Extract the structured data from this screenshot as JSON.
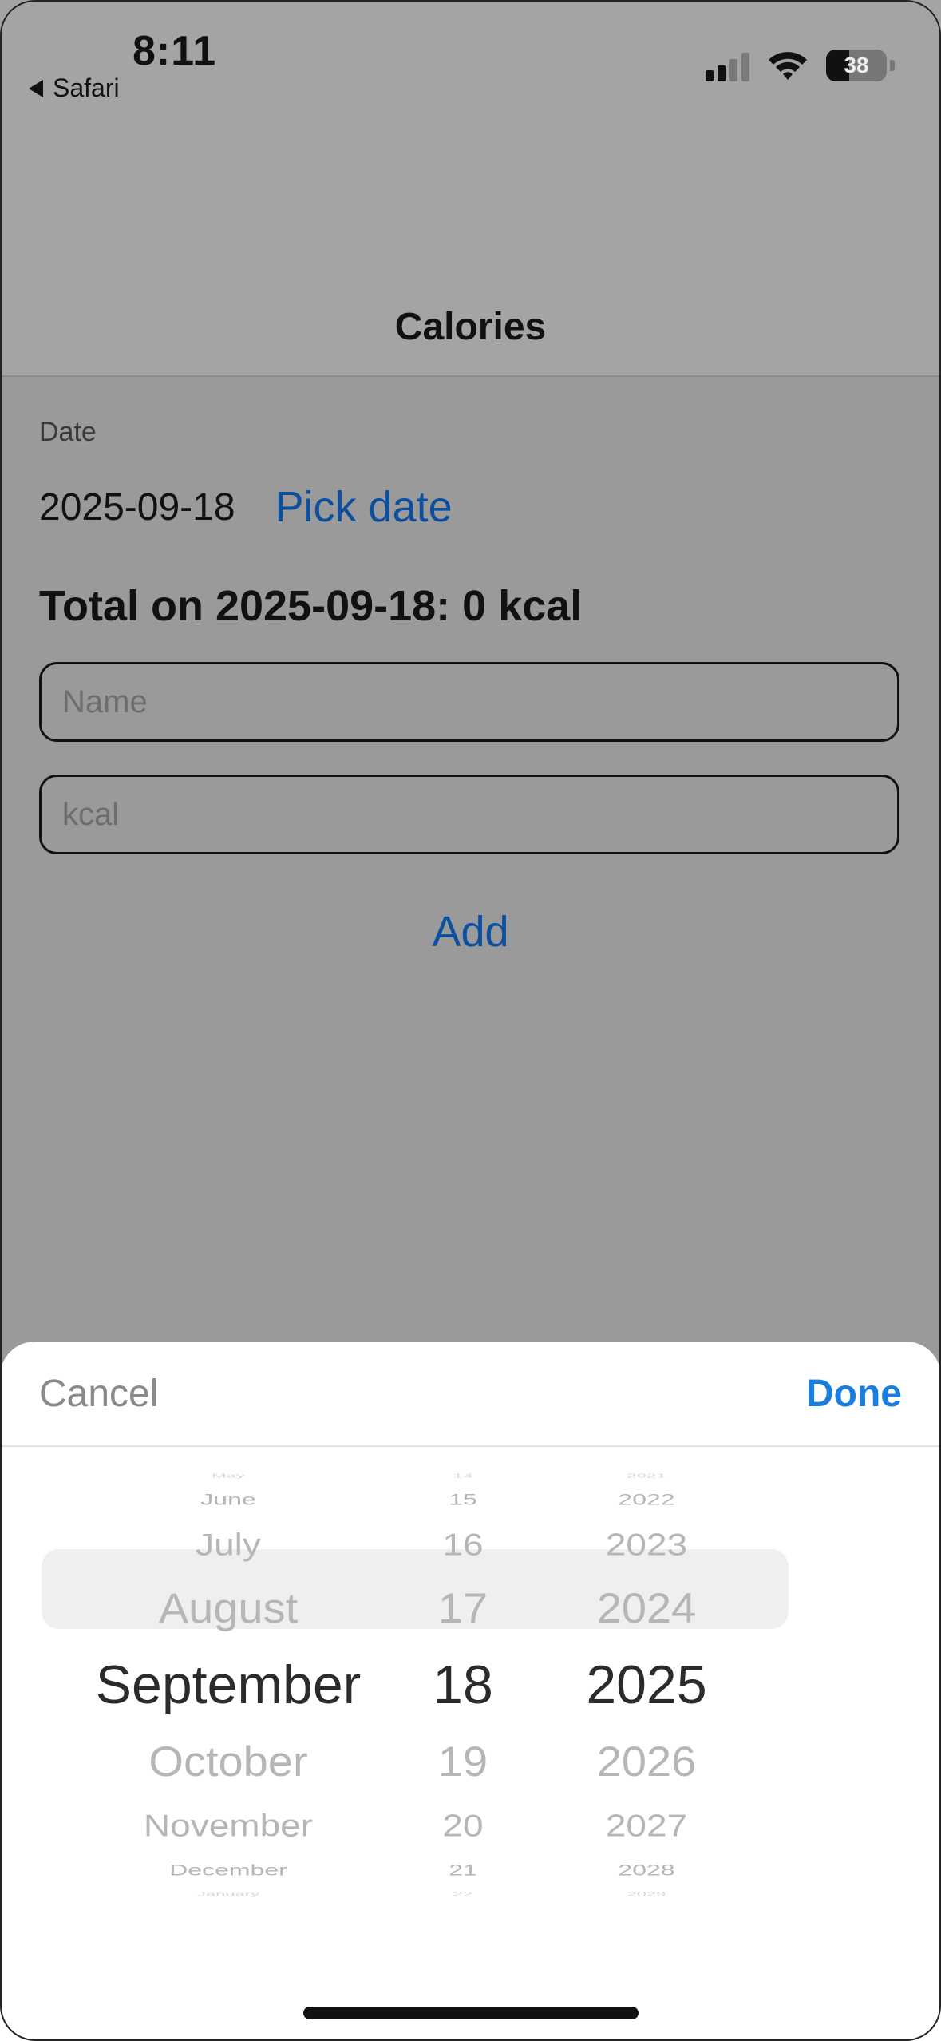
{
  "status_bar": {
    "time": "8:11",
    "back_app": "Safari",
    "battery": "38",
    "battery_level": 0.38
  },
  "nav": {
    "title": "Calories"
  },
  "form": {
    "date_label": "Date",
    "date_value": "2025-09-18",
    "pick_date_label": "Pick date",
    "total_text": "Total on 2025-09-18: 0 kcal",
    "name_placeholder": "Name",
    "kcal_placeholder": "kcal",
    "add_label": "Add"
  },
  "sheet": {
    "cancel_label": "Cancel",
    "done_label": "Done",
    "months": [
      "May",
      "June",
      "July",
      "August",
      "September",
      "October",
      "November",
      "December",
      "January"
    ],
    "days": [
      "14",
      "15",
      "16",
      "17",
      "18",
      "19",
      "20",
      "21",
      "22"
    ],
    "years": [
      "2021",
      "2022",
      "2023",
      "2024",
      "2025",
      "2026",
      "2027",
      "2028",
      "2029"
    ],
    "selected_index": 4
  }
}
